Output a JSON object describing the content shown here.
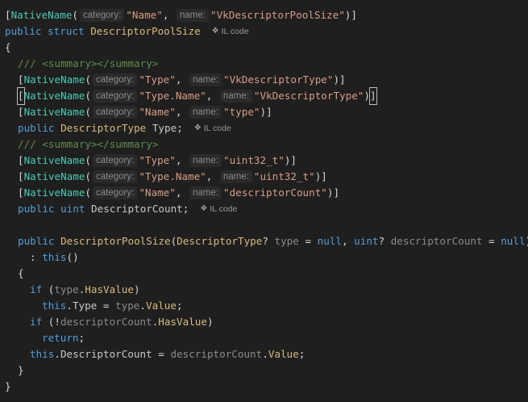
{
  "code": {
    "l1": {
      "open": "[",
      "attr": "NativeName",
      "paren": "(",
      "h1": "category:",
      "s1": "\"Name\"",
      "comma": ",",
      "h2": "name:",
      "s2": "\"VkDescriptorPoolSize\"",
      "close": ")]"
    },
    "l2": {
      "kw1": "public",
      "kw2": "struct",
      "type": "DescriptorPoolSize",
      "lens": "IL code"
    },
    "l3": {
      "brace": "{"
    },
    "l4": {
      "doc": "/// <summary></summary>"
    },
    "l5": {
      "open": "[",
      "attr": "NativeName",
      "paren": "(",
      "h1": "category:",
      "s1": "\"Type\"",
      "comma": ",",
      "h2": "name:",
      "s2": "\"VkDescriptorType\"",
      "close": ")]"
    },
    "l6": {
      "open": "[",
      "attr": "NativeName",
      "paren": "(",
      "h1": "category:",
      "s1": "\"Type.Name\"",
      "comma": ",",
      "h2": "name:",
      "s2": "\"VkDescriptorType\"",
      "close1": ")",
      "close2": "]"
    },
    "l7": {
      "open": "[",
      "attr": "NativeName",
      "paren": "(",
      "h1": "category:",
      "s1": "\"Name\"",
      "comma": ",",
      "h2": "name:",
      "s2": "\"type\"",
      "close": ")]"
    },
    "l8": {
      "kw1": "public",
      "type": "DescriptorType",
      "ident": "Type",
      "semi": ";",
      "lens": "IL code"
    },
    "l9": {
      "doc": "/// <summary></summary>"
    },
    "l10": {
      "open": "[",
      "attr": "NativeName",
      "paren": "(",
      "h1": "category:",
      "s1": "\"Type\"",
      "comma": ",",
      "h2": "name:",
      "s2": "\"uint32_t\"",
      "close": ")]"
    },
    "l11": {
      "open": "[",
      "attr": "NativeName",
      "paren": "(",
      "h1": "category:",
      "s1": "\"Type.Name\"",
      "comma": ",",
      "h2": "name:",
      "s2": "\"uint32_t\"",
      "close": ")]"
    },
    "l12": {
      "open": "[",
      "attr": "NativeName",
      "paren": "(",
      "h1": "category:",
      "s1": "\"Name\"",
      "comma": ",",
      "h2": "name:",
      "s2": "\"descriptorCount\"",
      "close": ")]"
    },
    "l13": {
      "kw1": "public",
      "kw2": "uint",
      "ident": "DescriptorCount",
      "semi": ";",
      "lens": "IL code"
    },
    "l14": {
      "kw1": "public",
      "type1": "DescriptorPoolSize",
      "p1": "(",
      "type2": "DescriptorType",
      "q1": "?",
      "param1": "type",
      "eq1": "=",
      "null1": "null",
      "comma": ",",
      "kw2": "uint",
      "q2": "?",
      "param2": "descriptorCount",
      "eq2": "=",
      "null2": "null",
      "p2": ")"
    },
    "l15": {
      "colon": ":",
      "kw": "this",
      "parens": "()"
    },
    "l16": {
      "brace": "{"
    },
    "l17": {
      "kw": "if",
      "p1": "(",
      "param": "type",
      "dot": ".",
      "member": "HasValue",
      "p2": ")"
    },
    "l18": {
      "kw": "this",
      "dot1": ".",
      "member1": "Type",
      "eq": "=",
      "param": "type",
      "dot2": ".",
      "member2": "Value",
      "semi": ";"
    },
    "l19": {
      "kw": "if",
      "p1": "(!",
      "param": "descriptorCount",
      "dot": ".",
      "member": "HasValue",
      "p2": ")"
    },
    "l20": {
      "kw": "return",
      "semi": ";"
    },
    "l21": {
      "kw": "this",
      "dot1": ".",
      "member1": "DescriptorCount",
      "eq": "=",
      "param": "descriptorCount",
      "dot2": ".",
      "member2": "Value",
      "semi": ";"
    },
    "l22": {
      "brace": "}"
    },
    "l23": {
      "brace": "}"
    }
  },
  "colors": {
    "background": "#1f1f1f",
    "attribute": "#4ec9b0",
    "string": "#d69d85",
    "keyword": "#569cd6",
    "type": "#d7ba7d",
    "doc_comment": "#608b4e"
  },
  "icons": {
    "code_lens": "il-code-icon"
  }
}
